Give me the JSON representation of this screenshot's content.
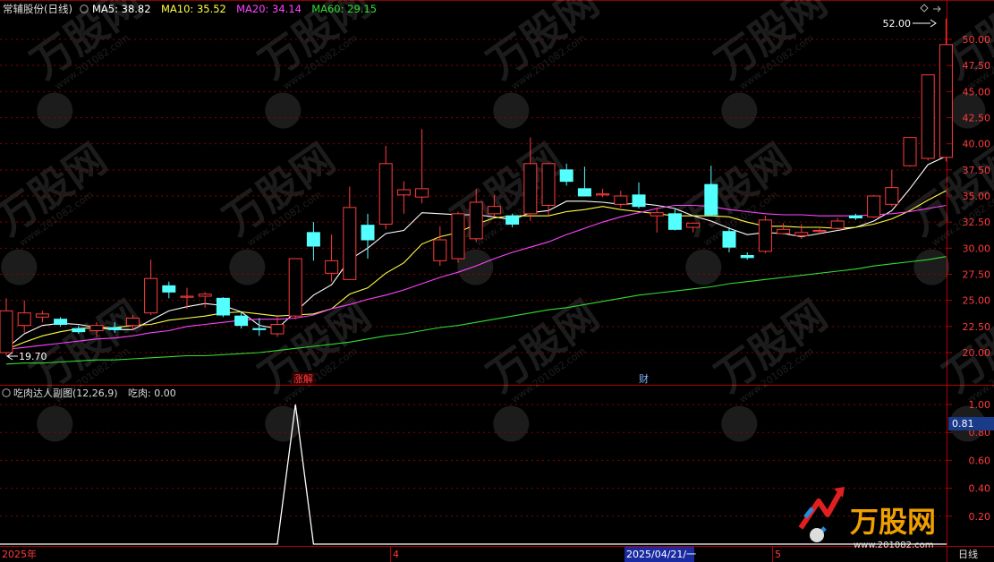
{
  "header": {
    "title": "常辅股份(日线)",
    "ma_items": [
      {
        "label": "MA5: 38.82",
        "color": "#ffffff"
      },
      {
        "label": "MA10: 35.52",
        "color": "#ffff44"
      },
      {
        "label": "MA20: 34.14",
        "color": "#ff44ff"
      },
      {
        "label": "MA60: 29.15",
        "color": "#33dd33"
      }
    ]
  },
  "sub_header": {
    "title": "吃肉达人副图(12,26,9)",
    "value_label": "吃肉: 0.00"
  },
  "annotations": {
    "high_label": "52.00",
    "low_label": "19.70",
    "event_1": "涨解",
    "event_2": "财",
    "sub_cursor_value": "0.81"
  },
  "bottom_axis": {
    "year_label": "2025年",
    "month_1": "4",
    "date_cursor": "2025/04/21/一",
    "month_2": "5",
    "period_label": "日线"
  },
  "watermark": {
    "brand": "万股网",
    "url": "www.201082.com"
  },
  "colors": {
    "up": "#ff3b3b",
    "down": "#54ffff",
    "grid": "#8b0000",
    "ma5": "#ffffff",
    "ma10": "#ffff44",
    "ma20": "#ff44ff",
    "ma60": "#33dd33"
  },
  "chart_data": [
    {
      "type": "candlestick",
      "y_ticks": [
        20.0,
        22.5,
        25.0,
        27.5,
        30.0,
        32.5,
        35.0,
        37.5,
        40.0,
        42.5,
        45.0,
        47.5,
        50.0
      ],
      "ylim": [
        18.7,
        52.0
      ],
      "grid": true,
      "candles": [
        {
          "o": 20.0,
          "h": 25.2,
          "l": 19.7,
          "c": 24.0
        },
        {
          "o": 22.6,
          "h": 25.0,
          "l": 21.9,
          "c": 23.8
        },
        {
          "o": 23.4,
          "h": 24.0,
          "l": 22.9,
          "c": 23.7
        },
        {
          "o": 23.2,
          "h": 23.4,
          "l": 22.5,
          "c": 22.7
        },
        {
          "o": 22.3,
          "h": 22.6,
          "l": 21.8,
          "c": 22.0
        },
        {
          "o": 22.1,
          "h": 22.9,
          "l": 21.5,
          "c": 22.6
        },
        {
          "o": 22.4,
          "h": 22.9,
          "l": 21.9,
          "c": 22.2
        },
        {
          "o": 22.6,
          "h": 23.6,
          "l": 22.2,
          "c": 23.3
        },
        {
          "o": 23.8,
          "h": 28.9,
          "l": 23.6,
          "c": 27.1
        },
        {
          "o": 26.4,
          "h": 26.8,
          "l": 25.2,
          "c": 25.8
        },
        {
          "o": 25.3,
          "h": 26.2,
          "l": 24.2,
          "c": 25.4
        },
        {
          "o": 25.4,
          "h": 25.8,
          "l": 24.3,
          "c": 25.6
        },
        {
          "o": 25.2,
          "h": 25.3,
          "l": 23.4,
          "c": 23.6
        },
        {
          "o": 23.5,
          "h": 23.9,
          "l": 22.3,
          "c": 22.6
        },
        {
          "o": 22.3,
          "h": 23.3,
          "l": 21.6,
          "c": 22.2
        },
        {
          "o": 21.8,
          "h": 23.6,
          "l": 21.5,
          "c": 22.7
        },
        {
          "o": 23.5,
          "h": 29.0,
          "l": 23.2,
          "c": 29.0
        },
        {
          "o": 31.5,
          "h": 32.5,
          "l": 28.8,
          "c": 30.2
        },
        {
          "o": 27.6,
          "h": 31.3,
          "l": 26.8,
          "c": 28.8
        },
        {
          "o": 27.0,
          "h": 35.9,
          "l": 27.0,
          "c": 33.9
        },
        {
          "o": 32.2,
          "h": 33.3,
          "l": 29.0,
          "c": 30.8
        },
        {
          "o": 32.3,
          "h": 39.8,
          "l": 31.8,
          "c": 38.1
        },
        {
          "o": 35.1,
          "h": 36.4,
          "l": 33.3,
          "c": 35.6
        },
        {
          "o": 34.9,
          "h": 41.4,
          "l": 34.3,
          "c": 35.7
        },
        {
          "o": 28.8,
          "h": 32.1,
          "l": 28.3,
          "c": 30.8
        },
        {
          "o": 29.0,
          "h": 33.5,
          "l": 28.6,
          "c": 33.3
        },
        {
          "o": 30.9,
          "h": 35.7,
          "l": 30.6,
          "c": 34.4
        },
        {
          "o": 33.3,
          "h": 35.1,
          "l": 33.0,
          "c": 34.0
        },
        {
          "o": 33.1,
          "h": 33.3,
          "l": 32.0,
          "c": 32.3
        },
        {
          "o": 33.3,
          "h": 40.6,
          "l": 32.6,
          "c": 38.1
        },
        {
          "o": 34.1,
          "h": 38.2,
          "l": 33.1,
          "c": 38.1
        },
        {
          "o": 37.5,
          "h": 38.1,
          "l": 36.0,
          "c": 36.4
        },
        {
          "o": 35.7,
          "h": 37.8,
          "l": 35.5,
          "c": 35.0
        },
        {
          "o": 35.1,
          "h": 35.7,
          "l": 34.9,
          "c": 35.2
        },
        {
          "o": 34.2,
          "h": 35.5,
          "l": 33.9,
          "c": 35.0
        },
        {
          "o": 35.1,
          "h": 36.3,
          "l": 33.8,
          "c": 34.0
        },
        {
          "o": 33.1,
          "h": 33.9,
          "l": 31.5,
          "c": 33.4
        },
        {
          "o": 33.3,
          "h": 33.8,
          "l": 31.7,
          "c": 31.8
        },
        {
          "o": 32.0,
          "h": 32.2,
          "l": 31.5,
          "c": 32.4
        },
        {
          "o": 36.1,
          "h": 37.9,
          "l": 33.1,
          "c": 33.2
        },
        {
          "o": 31.6,
          "h": 32.0,
          "l": 29.6,
          "c": 30.1
        },
        {
          "o": 29.3,
          "h": 29.6,
          "l": 28.9,
          "c": 29.1
        },
        {
          "o": 29.7,
          "h": 33.1,
          "l": 29.5,
          "c": 32.7
        },
        {
          "o": 31.4,
          "h": 32.4,
          "l": 31.3,
          "c": 31.8
        },
        {
          "o": 31.2,
          "h": 32.3,
          "l": 30.9,
          "c": 31.5
        },
        {
          "o": 31.6,
          "h": 31.9,
          "l": 31.4,
          "c": 31.7
        },
        {
          "o": 31.9,
          "h": 32.9,
          "l": 31.8,
          "c": 32.6
        },
        {
          "o": 33.1,
          "h": 33.3,
          "l": 32.7,
          "c": 32.9
        },
        {
          "o": 33.0,
          "h": 35.1,
          "l": 32.9,
          "c": 35.0
        },
        {
          "o": 34.2,
          "h": 37.5,
          "l": 34.0,
          "c": 35.8
        },
        {
          "o": 37.9,
          "h": 40.4,
          "l": 37.8,
          "c": 40.6
        },
        {
          "o": 38.6,
          "h": 46.6,
          "l": 38.4,
          "c": 46.6
        },
        {
          "o": 38.7,
          "h": 52.0,
          "l": 38.3,
          "c": 49.5
        }
      ],
      "series": [
        {
          "name": "MA5",
          "values": [
            20.4,
            21.8,
            22.6,
            22.8,
            22.7,
            22.4,
            22.2,
            22.2,
            23.1,
            24.0,
            24.4,
            24.7,
            24.5,
            23.9,
            22.6,
            22.3,
            23.9,
            25.5,
            26.5,
            28.9,
            30.0,
            31.4,
            31.7,
            33.4,
            33.3,
            33.2,
            33.2,
            33.0,
            32.7,
            33.4,
            33.6,
            34.5,
            34.5,
            34.4,
            34.2,
            34.3,
            34.1,
            33.8,
            33.1,
            32.6,
            31.9,
            31.3,
            31.5,
            31.4,
            31.1,
            31.4,
            31.7,
            32.0,
            32.6,
            33.6,
            35.7,
            38.0,
            38.8
          ]
        },
        {
          "name": "MA10",
          "values": [
            20.3,
            21.0,
            21.6,
            22.0,
            22.3,
            22.4,
            22.4,
            22.6,
            22.7,
            23.1,
            23.3,
            23.5,
            23.8,
            23.9,
            23.7,
            23.5,
            23.6,
            23.7,
            24.2,
            25.6,
            26.2,
            27.6,
            28.6,
            30.4,
            31.1,
            31.5,
            32.3,
            32.9,
            33.1,
            33.1,
            33.1,
            33.5,
            33.7,
            34.0,
            33.7,
            33.5,
            33.3,
            33.1,
            33.1,
            33.1,
            33.0,
            32.5,
            32.1,
            32.1,
            32.0,
            32.0,
            31.9,
            32.0,
            32.3,
            32.8,
            33.6,
            34.6,
            35.5
          ]
        },
        {
          "name": "MA20",
          "values": [
            20.3,
            20.5,
            20.7,
            20.9,
            21.1,
            21.3,
            21.4,
            21.6,
            21.9,
            22.1,
            22.5,
            22.7,
            22.9,
            23.1,
            23.2,
            23.2,
            23.3,
            23.6,
            24.2,
            24.6,
            25.1,
            25.5,
            26.0,
            26.6,
            27.2,
            27.7,
            28.3,
            29.0,
            29.6,
            30.1,
            30.6,
            31.3,
            31.9,
            32.5,
            33.0,
            33.4,
            33.8,
            34.1,
            34.1,
            34.0,
            33.7,
            33.5,
            33.3,
            33.2,
            33.2,
            33.1,
            33.1,
            33.1,
            33.2,
            33.3,
            33.5,
            33.8,
            34.1
          ]
        },
        {
          "name": "MA60",
          "values": [
            18.9,
            19.0,
            19.0,
            19.1,
            19.2,
            19.3,
            19.3,
            19.4,
            19.5,
            19.6,
            19.7,
            19.7,
            19.8,
            19.9,
            20.0,
            20.2,
            20.4,
            20.6,
            20.8,
            21.0,
            21.3,
            21.6,
            21.8,
            22.1,
            22.4,
            22.6,
            22.9,
            23.2,
            23.5,
            23.8,
            24.1,
            24.3,
            24.6,
            24.9,
            25.2,
            25.5,
            25.7,
            25.9,
            26.1,
            26.3,
            26.6,
            26.8,
            27.0,
            27.2,
            27.4,
            27.6,
            27.8,
            28.0,
            28.3,
            28.5,
            28.7,
            28.9,
            29.2
          ]
        }
      ]
    },
    {
      "type": "line",
      "y_ticks": [
        0.2,
        0.4,
        0.6,
        0.8,
        1.0
      ],
      "ylim": [
        0,
        1.06
      ],
      "grid": true,
      "series": [
        {
          "name": "吃肉",
          "values": [
            0,
            0,
            0,
            0,
            0,
            0,
            0,
            0,
            0,
            0,
            0,
            0,
            0,
            0,
            0,
            0,
            1,
            0,
            0,
            0,
            0,
            0,
            0,
            0,
            0,
            0,
            0,
            0,
            0,
            0,
            0,
            0,
            0,
            0,
            0,
            0,
            0,
            0,
            0,
            0,
            0,
            0,
            0,
            0,
            0,
            0,
            0,
            0,
            0,
            0,
            0,
            0,
            0
          ]
        }
      ]
    }
  ]
}
